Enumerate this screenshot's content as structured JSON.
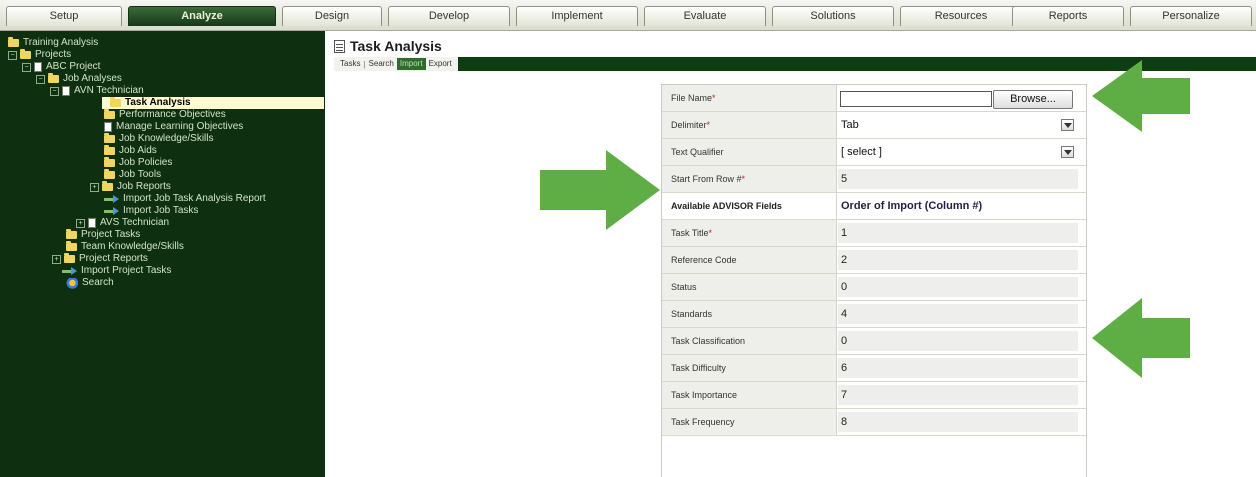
{
  "topnav": {
    "tabs": [
      {
        "label": "Setup",
        "active": false
      },
      {
        "label": "Analyze",
        "active": true
      },
      {
        "label": "Design",
        "active": false
      },
      {
        "label": "Develop",
        "active": false
      },
      {
        "label": "Implement",
        "active": false
      },
      {
        "label": "Evaluate",
        "active": false
      },
      {
        "label": "Solutions",
        "active": false
      },
      {
        "label": "Resources",
        "active": false
      },
      {
        "label": "Reports",
        "active": false
      },
      {
        "label": "Personalize",
        "active": false
      }
    ]
  },
  "sidebar": {
    "items": [
      {
        "label": "Training Analysis",
        "icon": "folder-icon"
      },
      {
        "label": "Projects",
        "icon": "folder-icon",
        "expander": "minus"
      },
      {
        "label": "ABC Project",
        "icon": "page-icon",
        "expander": "minus"
      },
      {
        "label": "Job Analyses",
        "icon": "folder-icon",
        "expander": "minus"
      },
      {
        "label": "AVN Technician",
        "icon": "page-icon",
        "expander": "minus"
      },
      {
        "label": "Task Analysis",
        "icon": "folder-icon",
        "selected": true
      },
      {
        "label": "Performance Objectives",
        "icon": "folder-icon"
      },
      {
        "label": "Manage Learning Objectives",
        "icon": "page-icon"
      },
      {
        "label": "Job Knowledge/Skills",
        "icon": "folder-icon"
      },
      {
        "label": "Job Aids",
        "icon": "folder-icon"
      },
      {
        "label": "Job Policies",
        "icon": "folder-icon"
      },
      {
        "label": "Job Tools",
        "icon": "folder-icon"
      },
      {
        "label": "Job Reports",
        "icon": "folder-icon",
        "expander": "plus"
      },
      {
        "label": "Import Job Task Analysis Report",
        "icon": "import-arrow-icon"
      },
      {
        "label": "Import Job Tasks",
        "icon": "import-arrow-icon"
      },
      {
        "label": "AVS Technician",
        "icon": "page-icon",
        "expander": "plus"
      },
      {
        "label": "Project Tasks",
        "icon": "folder-icon"
      },
      {
        "label": "Team Knowledge/Skills",
        "icon": "folder-icon"
      },
      {
        "label": "Project Reports",
        "icon": "folder-icon",
        "expander": "plus"
      },
      {
        "label": "Import Project Tasks",
        "icon": "import-arrow-icon"
      },
      {
        "label": "Search",
        "icon": "search-icon"
      }
    ]
  },
  "main": {
    "title": "Task Analysis",
    "subtabs": {
      "tasks": "Tasks",
      "sep": "|",
      "search": "Search",
      "import": "Import",
      "export": "Export",
      "active": "Import"
    }
  },
  "form": {
    "file_name_label": "File Name",
    "browse_label": "Browse...",
    "delimiter_label": "Delimiter",
    "delimiter_value": "Tab",
    "text_qualifier_label": "Text Qualifier",
    "text_qualifier_value": "[ select ]",
    "start_row_label": "Start From Row #",
    "start_row_value": "5",
    "required_mark": "*",
    "fields_header": "Available ADVISOR Fields",
    "order_header": "Order of Import (Column #)",
    "mappings": [
      {
        "field": "Task Title",
        "required": true,
        "column": "1"
      },
      {
        "field": "Reference Code",
        "required": false,
        "column": "2"
      },
      {
        "field": "Status",
        "required": false,
        "column": "0"
      },
      {
        "field": "Standards",
        "required": false,
        "column": "4"
      },
      {
        "field": "Task Classification",
        "required": false,
        "column": "0"
      },
      {
        "field": "Task Difficulty",
        "required": false,
        "column": "6"
      },
      {
        "field": "Task Importance",
        "required": false,
        "column": "7"
      },
      {
        "field": "Task Frequency",
        "required": false,
        "column": "8"
      }
    ]
  },
  "colors": {
    "sidebar_bg": "#0f2f11",
    "accent_green": "#5fae45",
    "selected_bg": "#fff9cf"
  }
}
